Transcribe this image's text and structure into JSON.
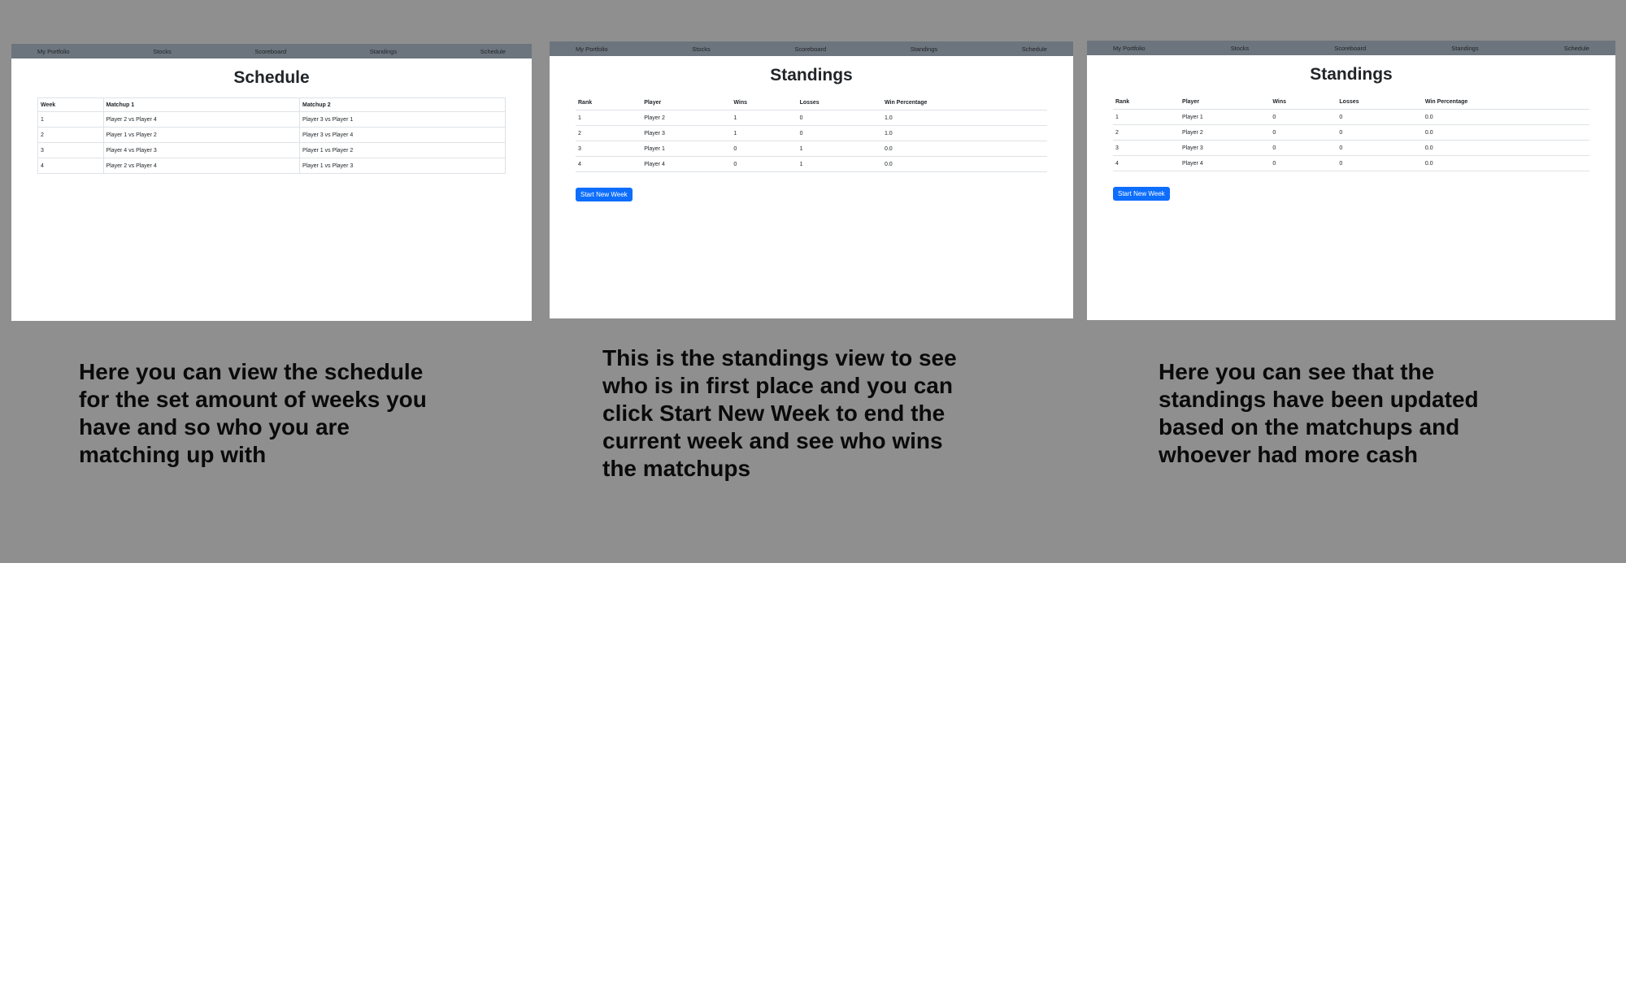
{
  "nav": [
    "My Portfolio",
    "Stocks",
    "Scoreboard",
    "Standings",
    "Schedule"
  ],
  "schedule": {
    "title": "Schedule",
    "headers": [
      "Week",
      "Matchup 1",
      "Matchup 2"
    ],
    "rows": [
      [
        "1",
        "Player 2 vs Player 4",
        "Player 3 vs Player 1"
      ],
      [
        "2",
        "Player 1 vs Player 2",
        "Player 3 vs Player 4"
      ],
      [
        "3",
        "Player 4 vs Player 3",
        "Player 1 vs Player 2"
      ],
      [
        "4",
        "Player 2 vs Player 4",
        "Player 1 vs Player 3"
      ]
    ],
    "caption": [
      "Here you can view the schedule",
      "for the set amount of weeks you",
      "have and so who you are",
      "matching up with"
    ]
  },
  "standings_after": {
    "title": "Standings",
    "headers": [
      "Rank",
      "Player",
      "Wins",
      "Losses",
      "Win Percentage"
    ],
    "rows": [
      [
        "1",
        "Player 2",
        "1",
        "0",
        "1.0"
      ],
      [
        "2",
        "Player 3",
        "1",
        "0",
        "1.0"
      ],
      [
        "3",
        "Player 1",
        "0",
        "1",
        "0.0"
      ],
      [
        "4",
        "Player 4",
        "0",
        "1",
        "0.0"
      ]
    ],
    "button": "Start New Week",
    "caption": [
      "This is the standings view to see",
      "who is in first place and you can",
      "click Start New Week to end the",
      "current week and see who wins",
      "the matchups"
    ]
  },
  "standings_before": {
    "title": "Standings",
    "headers": [
      "Rank",
      "Player",
      "Wins",
      "Losses",
      "Win Percentage"
    ],
    "rows": [
      [
        "1",
        "Player 1",
        "0",
        "0",
        "0.0"
      ],
      [
        "2",
        "Player 2",
        "0",
        "0",
        "0.0"
      ],
      [
        "3",
        "Player 3",
        "0",
        "0",
        "0.0"
      ],
      [
        "4",
        "Player 4",
        "0",
        "0",
        "0.0"
      ]
    ],
    "button": "Start New Week",
    "caption": [
      "Here you can see that the",
      "standings have been updated",
      "based on the matchups and",
      "whoever had more cash"
    ]
  },
  "colors": {
    "slide_background": "#8f8f8f",
    "navbar": "#6c757d",
    "button": "#0d6efd",
    "page": "#ffffff"
  }
}
